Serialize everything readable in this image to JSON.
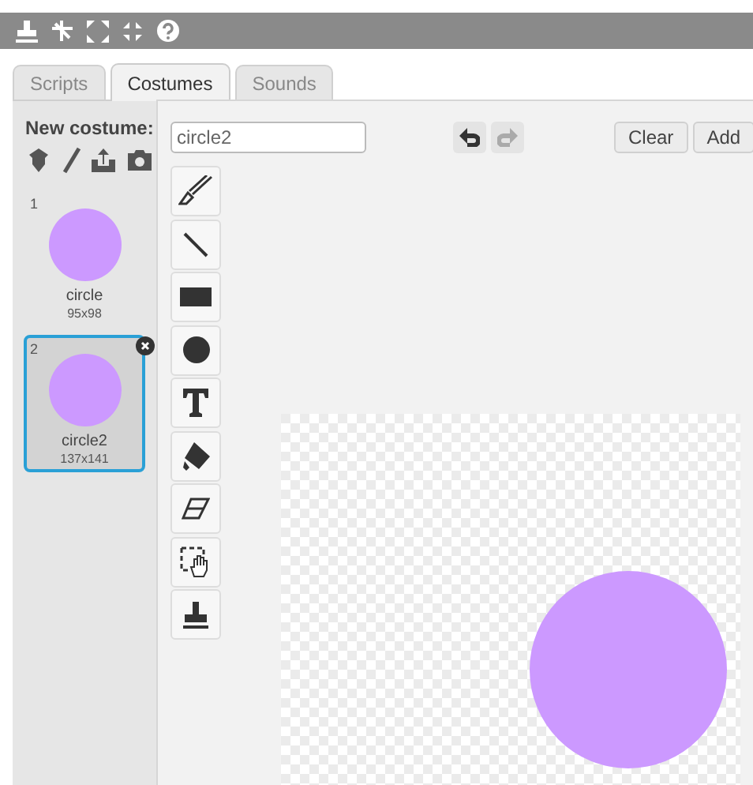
{
  "tabs": [
    {
      "label": "Scripts",
      "selected": false
    },
    {
      "label": "Costumes",
      "selected": true
    },
    {
      "label": "Sounds",
      "selected": false
    }
  ],
  "new_costume": {
    "label": "New costume:"
  },
  "costumes": [
    {
      "number": "1",
      "name": "circle",
      "size": "95x98",
      "selected": false
    },
    {
      "number": "2",
      "name": "circle2",
      "size": "137x141",
      "selected": true
    }
  ],
  "editor": {
    "name_field": {
      "value": "circle2"
    },
    "buttons": [
      "Clear",
      "Add"
    ]
  }
}
